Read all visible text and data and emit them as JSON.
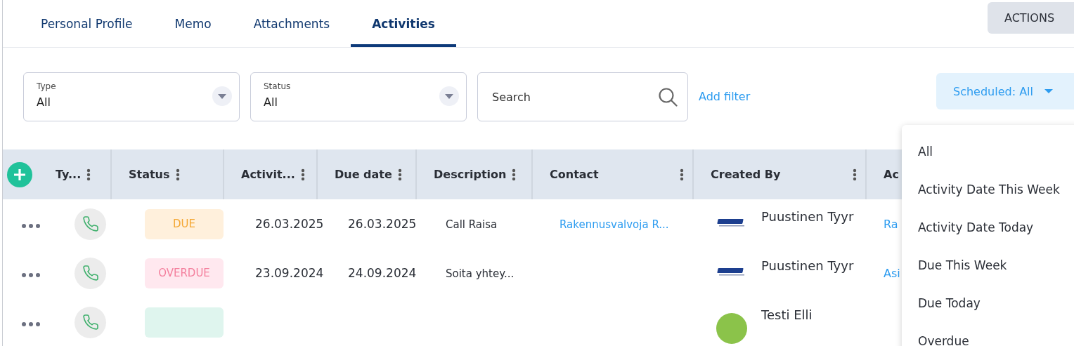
{
  "tabs": [
    {
      "label": "Personal Profile",
      "selected": false
    },
    {
      "label": "Memo",
      "selected": false
    },
    {
      "label": "Attachments",
      "selected": false
    },
    {
      "label": "Activities",
      "selected": true
    }
  ],
  "actions_button": {
    "label": "ACTIONS"
  },
  "filters": [
    {
      "kind": "select",
      "label": "Type",
      "value": "All"
    },
    {
      "kind": "select",
      "label": "Status",
      "value": "All"
    },
    {
      "kind": "search",
      "placeholder": "Search"
    }
  ],
  "add_filter": "Add filter",
  "scheduled_button": {
    "label": "Scheduled: All",
    "expanded": true
  },
  "table": {
    "columns": [
      {
        "label": "Ty..."
      },
      {
        "label": "Status"
      },
      {
        "label": "Activit..."
      },
      {
        "label": "Due date"
      },
      {
        "label": "Description"
      },
      {
        "label": "Contact"
      },
      {
        "label": "Created By"
      },
      {
        "label": "Ac"
      }
    ],
    "rows": [
      {
        "type": {
          "kind": "call"
        },
        "status": {
          "label": "DUE",
          "kind": "due"
        },
        "activity_date": "26.03.2025",
        "due_date": "26.03.2025",
        "description": "Call Raisa",
        "contact": "Rakennusvalvoja R...",
        "created_by": {
          "kind": "logo",
          "name": "Puustinen Tyyr"
        },
        "account": "Ra"
      },
      {
        "type": {
          "kind": "call"
        },
        "status": {
          "label": "OVERDUE",
          "kind": "overdue"
        },
        "activity_date": "23.09.2024",
        "due_date": "24.09.2024",
        "description": "Soita yhtey...",
        "created_by": {
          "kind": "logo",
          "name": "Puustinen Tyyr"
        },
        "account": "Asi"
      },
      {
        "type": {
          "kind": "call"
        },
        "status": {
          "kind": "done"
        },
        "created_by": {
          "kind": "avatar",
          "color": "#8bc34a",
          "name": "Testi Elli"
        }
      }
    ]
  },
  "scheduled_menu": [
    {
      "label": "All"
    },
    {
      "label": "Activity Date This Week"
    },
    {
      "label": "Activity Date Today"
    },
    {
      "label": "Due This Week"
    },
    {
      "label": "Due Today"
    },
    {
      "label": "Overdue"
    }
  ]
}
